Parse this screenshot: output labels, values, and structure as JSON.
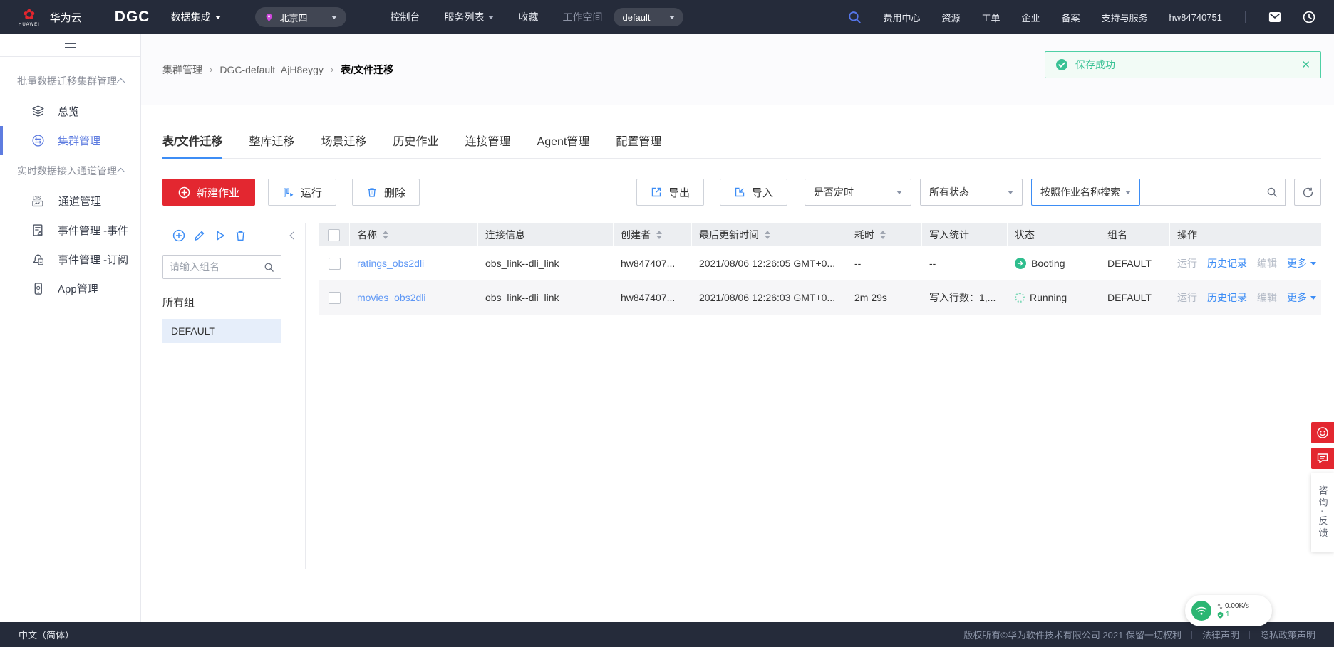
{
  "nav": {
    "logo_text": "HUAWEI",
    "brand": "华为云",
    "product": "DGC",
    "module": "数据集成",
    "region": "北京四",
    "console": "控制台",
    "services": "服务列表",
    "favorites": "收藏",
    "workspace_label": "工作空间",
    "workspace_value": "default",
    "links": [
      "费用中心",
      "资源",
      "工单",
      "企业",
      "备案",
      "支持与服务",
      "hw84740751"
    ]
  },
  "sidebar": {
    "sections": [
      {
        "title": "批量数据迁移集群管理",
        "items": [
          {
            "label": "总览"
          },
          {
            "label": "集群管理"
          }
        ]
      },
      {
        "title": "实时数据接入通道管理",
        "items": [
          {
            "label": "通道管理"
          },
          {
            "label": "事件管理 -事件"
          },
          {
            "label": "事件管理 -订阅"
          },
          {
            "label": "App管理"
          }
        ]
      }
    ]
  },
  "breadcrumb": {
    "items": [
      "集群管理",
      "DGC-default_AjH8eygy",
      "表/文件迁移"
    ]
  },
  "toast": {
    "message": "保存成功"
  },
  "tabs": [
    "表/文件迁移",
    "整库迁移",
    "场景迁移",
    "历史作业",
    "连接管理",
    "Agent管理",
    "配置管理"
  ],
  "toolbar": {
    "new_job": "新建作业",
    "run": "运行",
    "delete": "删除",
    "export": "导出",
    "import": "导入",
    "schedule_filter": "是否定时",
    "status_filter": "所有状态",
    "search_type": "按照作业名称搜索"
  },
  "groups": {
    "search_placeholder": "请输入组名",
    "all_label": "所有组",
    "items": [
      "DEFAULT"
    ]
  },
  "table": {
    "columns": [
      "名称",
      "连接信息",
      "创建者",
      "最后更新时间",
      "耗时",
      "写入统计",
      "状态",
      "组名",
      "操作"
    ],
    "ops": {
      "run": "运行",
      "history": "历史记录",
      "edit": "编辑",
      "more": "更多"
    },
    "rows": [
      {
        "name": "ratings_obs2dli",
        "connection": "obs_link--dli_link",
        "creator": "hw847407...",
        "updated": "2021/08/06 12:26:05 GMT+0...",
        "duration": "--",
        "stats": "--",
        "status": "Booting",
        "group": "DEFAULT"
      },
      {
        "name": "movies_obs2dli",
        "connection": "obs_link--dli_link",
        "creator": "hw847407...",
        "updated": "2021/08/06 12:26:03 GMT+0...",
        "duration": "2m 29s",
        "stats": "写入行数：1,...",
        "status": "Running",
        "group": "DEFAULT"
      }
    ]
  },
  "footer": {
    "language": "中文（简体）",
    "copyright": "版权所有©华为软件技术有限公司 2021 保留一切权利",
    "links": [
      "法律声明",
      "隐私政策声明"
    ]
  },
  "float": {
    "feedback": "咨询·反馈",
    "speed": "0.00K/s",
    "count": "1"
  },
  "colors": {
    "accent": "#3d8df5",
    "danger": "#e32730",
    "success": "#3ac295",
    "sidebar_active": "#5e7ce0",
    "nav_bg": "#252b3a"
  }
}
